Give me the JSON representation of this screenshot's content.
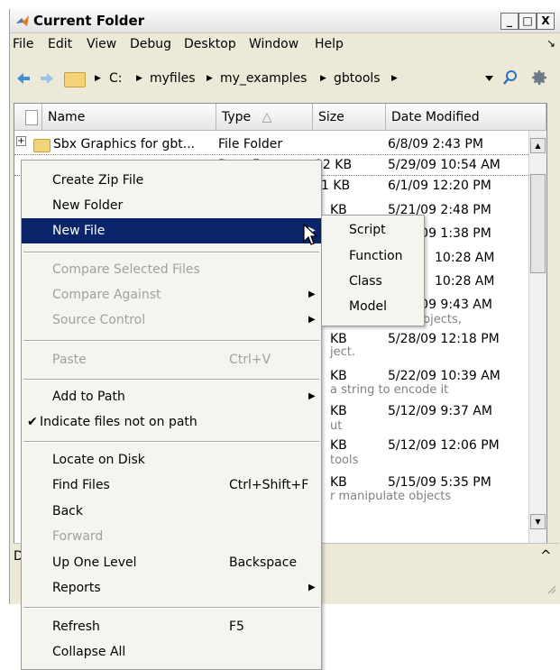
{
  "window": {
    "title": "Current Folder",
    "controls": {
      "minimize": "_",
      "maximize": "□",
      "close": "X"
    }
  },
  "menubar": {
    "items": [
      "File",
      "Edit",
      "View",
      "Debug",
      "Desktop",
      "Window",
      "Help"
    ],
    "undock_glyph": "↘"
  },
  "toolbar": {
    "breadcrumbs": [
      "C:",
      "myfiles",
      "my_examples",
      "gbtools"
    ]
  },
  "file_list": {
    "columns": [
      "Name",
      "Type",
      "Size",
      "Date Modified"
    ],
    "sort_indicator": "△",
    "folder_row": {
      "expander": "+",
      "name": "Sbx Graphics for gbt...",
      "type": "File Folder",
      "size": "",
      "date": "6/8/09 2:43 PM"
    },
    "rows": [
      {
        "type": "Data F...",
        "size": "12 KB",
        "date": "5/29/09 10:54 AM"
      },
      {
        "size": "1 KB",
        "date": "6/1/09 12:20 PM"
      },
      {
        "size": "KB",
        "date": "5/21/09 2:48 PM"
      },
      {
        "size": "KB",
        "date": "5/21/09 1:38 PM"
      },
      {
        "size": "KB",
        "date": "10:28 AM"
      },
      {
        "size": "KB",
        "date": "10:28 AM"
      },
      {
        "size": "KB",
        "date": "5/21/09 9:43 AM"
      },
      {
        "desc": "to manipulate objects,"
      },
      {
        "size": "KB",
        "date": "5/28/09 12:18 PM"
      },
      {
        "desc": "ject."
      },
      {
        "size": "KB",
        "date": "5/22/09 10:39 AM"
      },
      {
        "desc": "a string to encode it"
      },
      {
        "size": "KB",
        "date": "5/12/09 9:37 AM"
      },
      {
        "desc": "ut"
      },
      {
        "size": "KB",
        "date": "5/12/09 12:06 PM"
      },
      {
        "desc": "tools"
      },
      {
        "size": "KB",
        "date": "5/15/09 5:35 PM"
      },
      {
        "desc": "r manipulate objects"
      }
    ]
  },
  "detail_bar": {
    "left_label": "D",
    "collapse_glyph": "^"
  },
  "context_menu": {
    "items": [
      {
        "label": "Create Zip File"
      },
      {
        "label": "New Folder"
      },
      {
        "label": "New File",
        "submenu": true,
        "highlighted": true
      },
      {
        "separator": true
      },
      {
        "label": "Compare Selected Files",
        "disabled": true
      },
      {
        "label": "Compare Against",
        "disabled": true,
        "submenu": true
      },
      {
        "label": "Source Control",
        "disabled": true,
        "submenu": true
      },
      {
        "separator": true
      },
      {
        "label": "Paste",
        "disabled": true,
        "shortcut": "Ctrl+V"
      },
      {
        "separator": true
      },
      {
        "label": "Add to Path",
        "submenu": true
      },
      {
        "label": "Indicate files not on path",
        "checked": true
      },
      {
        "separator": true
      },
      {
        "label": "Locate on Disk"
      },
      {
        "label": "Find Files",
        "shortcut": "Ctrl+Shift+F"
      },
      {
        "label": "Back"
      },
      {
        "label": "Forward",
        "disabled": true
      },
      {
        "label": "Up One Level",
        "shortcut": "Backspace"
      },
      {
        "label": "Reports",
        "submenu": true
      },
      {
        "separator": true
      },
      {
        "label": "Refresh",
        "shortcut": "F5"
      },
      {
        "label": "Collapse All"
      }
    ]
  },
  "submenu": {
    "items": [
      "Script",
      "Function",
      "Class",
      "Model"
    ]
  },
  "colors": {
    "highlight": "#0a246a",
    "disabled_text": "#a0a0a0",
    "window_bg": "#ece9d8",
    "folder": "#f3d37a"
  }
}
